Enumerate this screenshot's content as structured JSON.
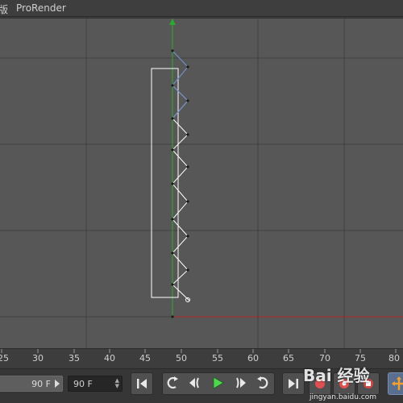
{
  "menubar": {
    "cut_item": "版",
    "prorender": "ProRender"
  },
  "timeline": {
    "ticks": [
      "25",
      "30",
      "35",
      "40",
      "45",
      "50",
      "55",
      "60",
      "65",
      "70",
      "75",
      "80"
    ]
  },
  "transport": {
    "start_frame": "90 F",
    "end_frame": "90 F"
  },
  "colors": {
    "viewport_bg": "#575757",
    "grid_line": "#404040",
    "y_axis": "#2fa82f",
    "x_axis": "#b02828",
    "spline": "#ffffff",
    "spline_selected": "#6f8fc8",
    "play_icon": "#4fd84f",
    "record_red": "#e05050",
    "move_orange": "#f0a030"
  },
  "icons": [
    "go-to-start-icon",
    "loop-icon",
    "prev-key-icon",
    "play-icon",
    "next-key-icon",
    "loop-forward-icon",
    "go-to-end-icon",
    "record-icon",
    "autokey-icon",
    "keyframe-icon",
    "move-tool-icon"
  ],
  "watermark": {
    "main": "Bai 经验",
    "sub": "jingyan.baidu.com"
  }
}
